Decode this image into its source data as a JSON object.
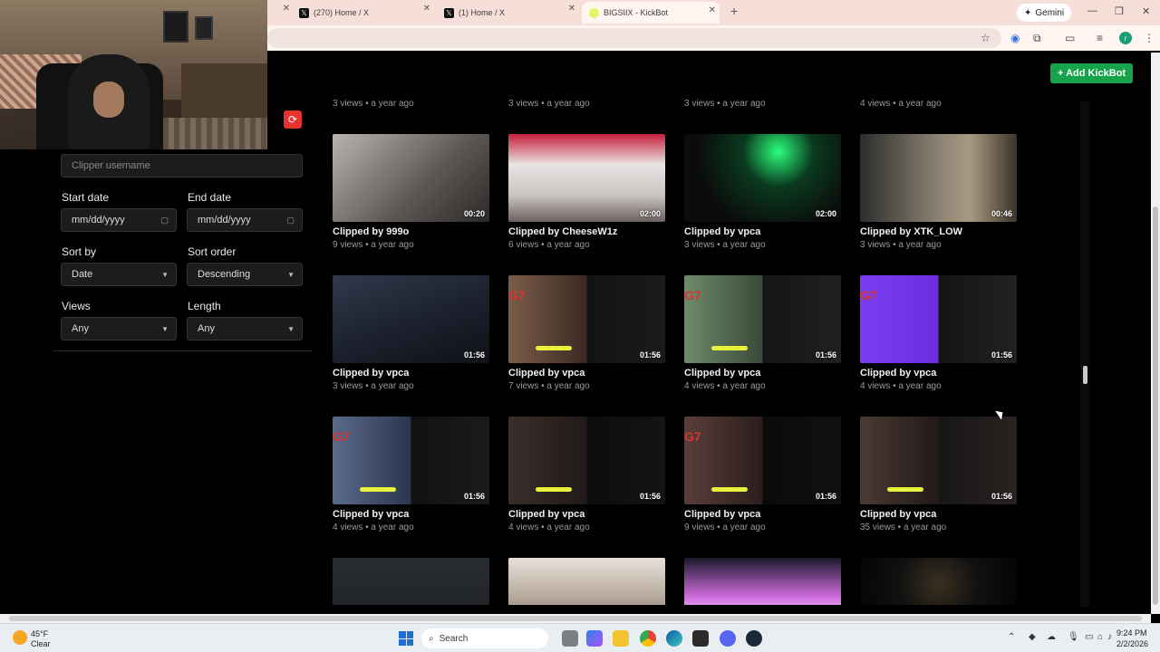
{
  "browser": {
    "tabs": [
      {
        "title": "(270) Home / X",
        "icon": "x-logo-icon"
      },
      {
        "title": "(1) Home / X",
        "icon": "x-logo-icon"
      },
      {
        "title": "BIGSIIX - KickBot",
        "icon": "kickbot-icon",
        "active": true
      }
    ],
    "new_tab_label": "+",
    "gemini_label": "Gemini"
  },
  "header": {
    "add_button_label": "+ Add KickBot"
  },
  "filters": {
    "clipper_placeholder": "Clipper username",
    "start_date_label": "Start date",
    "start_date_value": "mm/dd/yyyy",
    "end_date_label": "End date",
    "end_date_value": "mm/dd/yyyy",
    "sort_by_label": "Sort by",
    "sort_by_value": "Date",
    "sort_order_label": "Sort order",
    "sort_order_value": "Descending",
    "views_label": "Views",
    "views_value": "Any",
    "length_label": "Length",
    "length_value": "Any"
  },
  "top_row_meta": [
    "3 views • a year ago",
    "3 views • a year ago",
    "3 views • a year ago",
    "4 views • a year ago"
  ],
  "clips": [
    {
      "title": "Clipped by 999o",
      "meta": "9 views • a year ago",
      "duration": "00:20"
    },
    {
      "title": "Clipped by CheeseW1z",
      "meta": "6 views • a year ago",
      "duration": "02:00"
    },
    {
      "title": "Clipped by vpca",
      "meta": "3 views • a year ago",
      "duration": "02:00"
    },
    {
      "title": "Clipped by XTK_LOW",
      "meta": "3 views • a year ago",
      "duration": "00:46"
    },
    {
      "title": "Clipped by vpca",
      "meta": "3 views • a year ago",
      "duration": "01:56"
    },
    {
      "title": "Clipped by vpca",
      "meta": "7 views • a year ago",
      "duration": "01:56"
    },
    {
      "title": "Clipped by vpca",
      "meta": "4 views • a year ago",
      "duration": "01:56"
    },
    {
      "title": "Clipped by vpca",
      "meta": "4 views • a year ago",
      "duration": "01:56"
    },
    {
      "title": "Clipped by vpca",
      "meta": "4 views • a year ago",
      "duration": "01:56"
    },
    {
      "title": "Clipped by vpca",
      "meta": "4 views • a year ago",
      "duration": "01:56"
    },
    {
      "title": "Clipped by vpca",
      "meta": "9 views • a year ago",
      "duration": "01:56"
    },
    {
      "title": "Clipped by vpca",
      "meta": "35 views • a year ago",
      "duration": "01:56"
    }
  ],
  "overlay_text": {
    "g7": "G7"
  },
  "taskbar": {
    "weather_temp": "45°F",
    "weather_cond": "Clear",
    "search_label": "Search",
    "time": "9:24 PM",
    "date": "2/2/2026"
  }
}
